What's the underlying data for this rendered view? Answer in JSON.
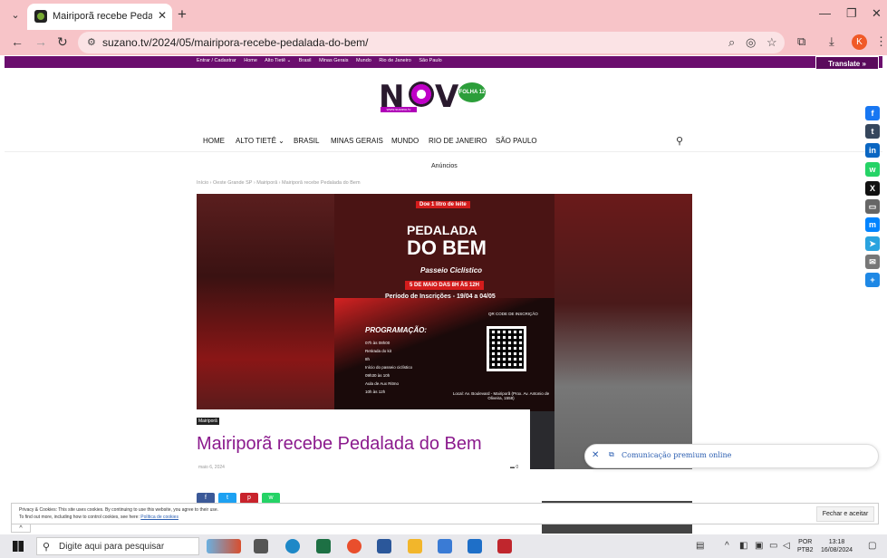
{
  "browser": {
    "tab_title": "Mairiporã recebe Pedalada do B",
    "url": "suzano.tv/2024/05/mairipora-recebe-pedalada-do-bem/",
    "profile_initial": "K"
  },
  "topnav": {
    "links": [
      "Entrar / Cadastrar",
      "Home",
      "Alto Tietê ⌄",
      "Brasil",
      "Minas Gerais",
      "Mundo",
      "Rio de Janeiro",
      "São Paulo"
    ],
    "translate": "Translate »"
  },
  "logo": {
    "text": "NOV",
    "badge": "FOLHA 12",
    "sub": "www.suzano.tv"
  },
  "menu": [
    "HOME",
    "ALTO TIETÊ ⌄",
    "BRASIL",
    "MINAS GERAIS",
    "MUNDO",
    "RIO DE JANEIRO",
    "SÃO PAULO"
  ],
  "ads_label": "Anúncios",
  "breadcrumb": "Início  ›  Oeste Grande SP  ›  Mairiporã  ›  Mairiporã recebe Pedalada do Bem",
  "poster": {
    "tag": "Doe 1 litro de leite",
    "title_line1": "PEDALADA",
    "title_line2": "DO BEM",
    "subtitle": "Passeio Ciclístico",
    "date": "5 DE MAIO DAS 8H ÀS 12H",
    "period": "Período de Inscrições - 19/04 a 04/05",
    "program": "PROGRAMAÇÃO:",
    "qr_label": "QR CODE DE INSCRIÇÃO",
    "list": [
      "07h às 08h00",
      "Retirada do kit",
      "8h",
      "Início do passeio ciclístico",
      "09h30 às 10h",
      "Aula de Aux Ritmo",
      "10h às 12h"
    ],
    "local": "Local: Av. Boulevard - Mairiporã (Prox. Av. Antonio de Oliveira, 1558)"
  },
  "article": {
    "category": "Mairiporã",
    "headline": "Mairiporã recebe Pedalada do Bem",
    "date": "maio 6, 2024",
    "comments": "0"
  },
  "premium": {
    "text": "Comunicação premium online"
  },
  "cookie": {
    "line1": "Privacy & Cookies: This site uses cookies. By continuing to use this website, you agree to their use.",
    "line2": "To find out more, including how to control cookies, see here: ",
    "link": "Política de cookies",
    "button": "Fechar e aceitar"
  },
  "taskbar": {
    "search_placeholder": "Digite aqui para pesquisar",
    "lang1": "POR",
    "lang2": "PTB2",
    "time": "13:18",
    "date": "16/08/2024"
  },
  "colors": {
    "brand_purple": "#6b0e6e",
    "headline": "#8b1a8d",
    "tab_bar": "#f7c4c8"
  }
}
